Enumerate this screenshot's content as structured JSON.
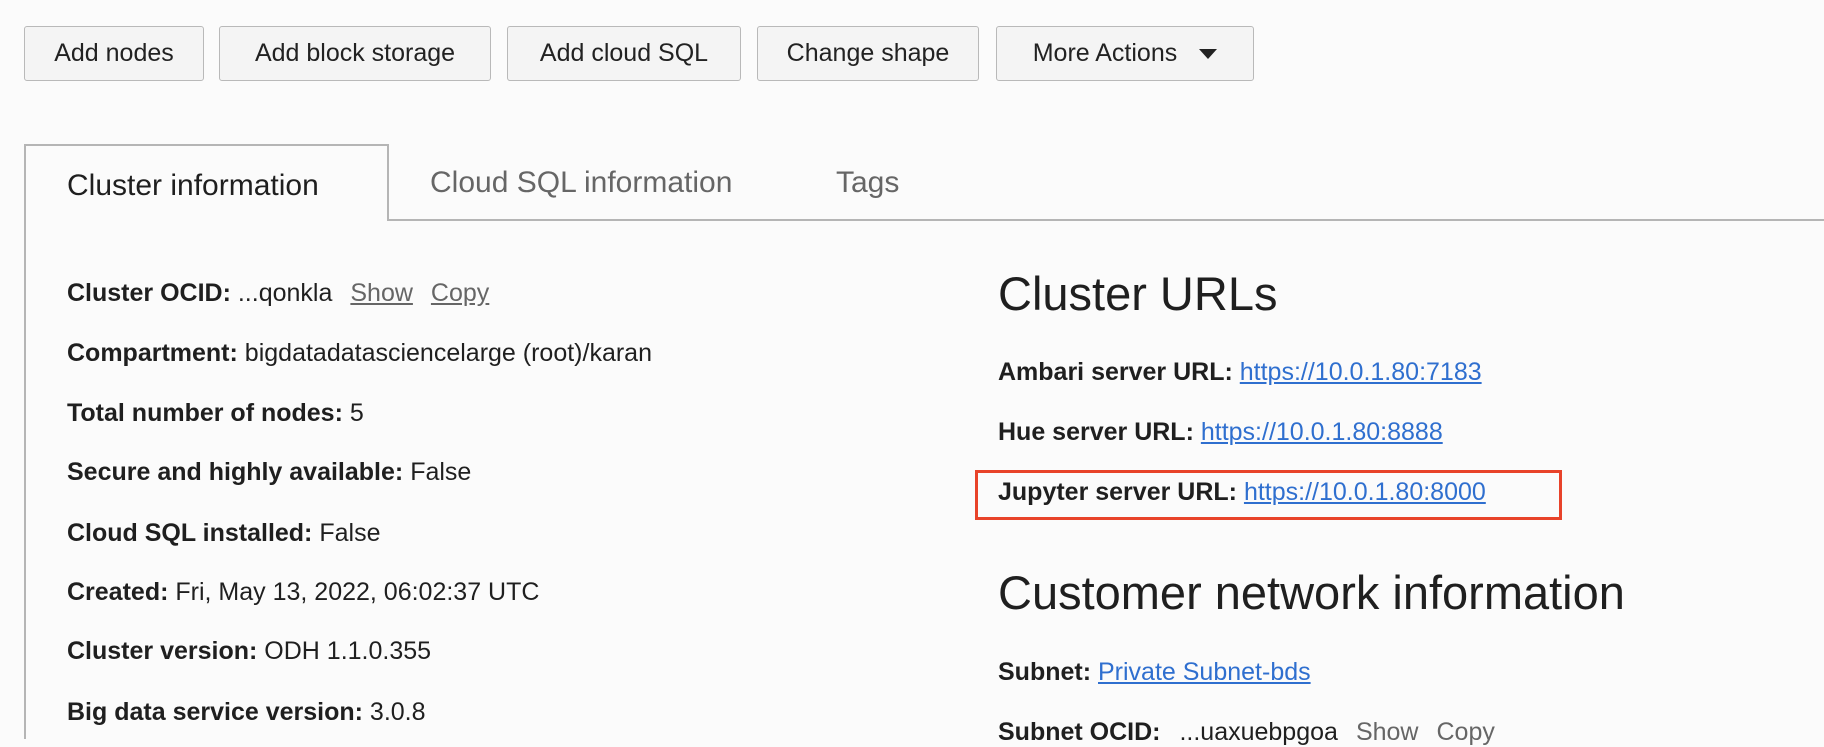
{
  "toolbar": {
    "add_nodes": "Add nodes",
    "add_block_storage": "Add block storage",
    "add_cloud_sql": "Add cloud SQL",
    "change_shape": "Change shape",
    "more_actions": "More Actions"
  },
  "tabs": [
    "Cluster information",
    "Cloud SQL information",
    "Tags"
  ],
  "cluster_info": {
    "ocid_label": "Cluster OCID:",
    "ocid_value": "...qonkla",
    "show": "Show",
    "copy": "Copy",
    "compartment_label": "Compartment:",
    "compartment_value": "bigdatadatasciencelarge (root)/karan",
    "nodes_label": "Total number of nodes:",
    "nodes_value": "5",
    "secure_label": "Secure and highly available:",
    "secure_value": "False",
    "cloudsql_label": "Cloud SQL installed:",
    "cloudsql_value": "False",
    "created_label": "Created:",
    "created_value": "Fri, May 13, 2022, 06:02:37 UTC",
    "version_label": "Cluster version:",
    "version_value": "ODH 1.1.0.355",
    "bds_label": "Big data service version:",
    "bds_value": "3.0.8"
  },
  "cluster_urls": {
    "heading": "Cluster URLs",
    "ambari_label": "Ambari server URL:",
    "ambari_url": "https://10.0.1.80:7183",
    "hue_label": "Hue server URL:",
    "hue_url": "https://10.0.1.80:8888",
    "jupyter_label": "Jupyter server URL:",
    "jupyter_url": "https://10.0.1.80:8000"
  },
  "network": {
    "heading": "Customer network information",
    "subnet_label": "Subnet:",
    "subnet_value": "Private Subnet-bds",
    "subnet_ocid_label": "Subnet OCID:",
    "subnet_ocid_value": "...uaxuebpgoa",
    "show": "Show",
    "copy": "Copy"
  }
}
